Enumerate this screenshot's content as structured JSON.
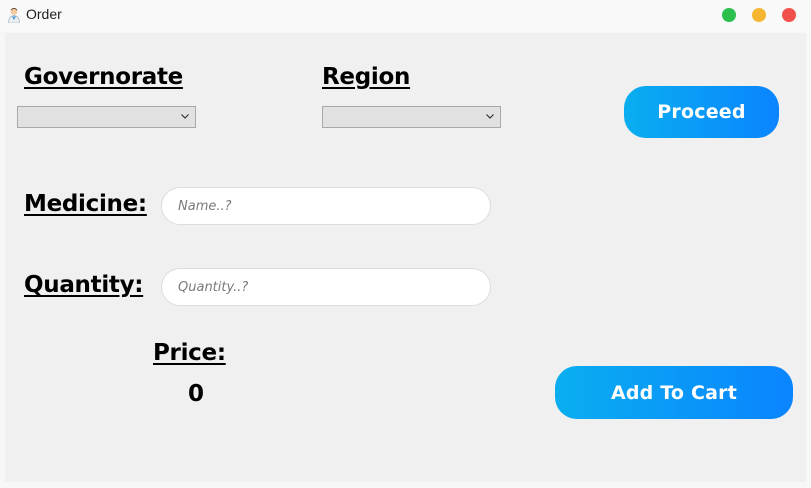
{
  "window": {
    "title": "Order",
    "icon": "doctor-avatar-icon",
    "controls": [
      "green-dot",
      "yellow-dot",
      "red-dot"
    ]
  },
  "colors": {
    "button_gradient_start": "#0aaef0",
    "button_gradient_end": "#0a84ff",
    "panel_background": "#f0f0f0"
  },
  "form": {
    "governorate_label": "Governorate",
    "governorate_value": "",
    "region_label": "Region",
    "region_value": "",
    "proceed_label": "Proceed",
    "medicine_label": "Medicine:",
    "medicine_placeholder": "Name..?",
    "medicine_value": "",
    "quantity_label": "Quantity:",
    "quantity_placeholder": "Quantity..?",
    "quantity_value": "",
    "price_label": "Price:",
    "price_value": "0",
    "add_to_cart_label": "Add To Cart"
  }
}
